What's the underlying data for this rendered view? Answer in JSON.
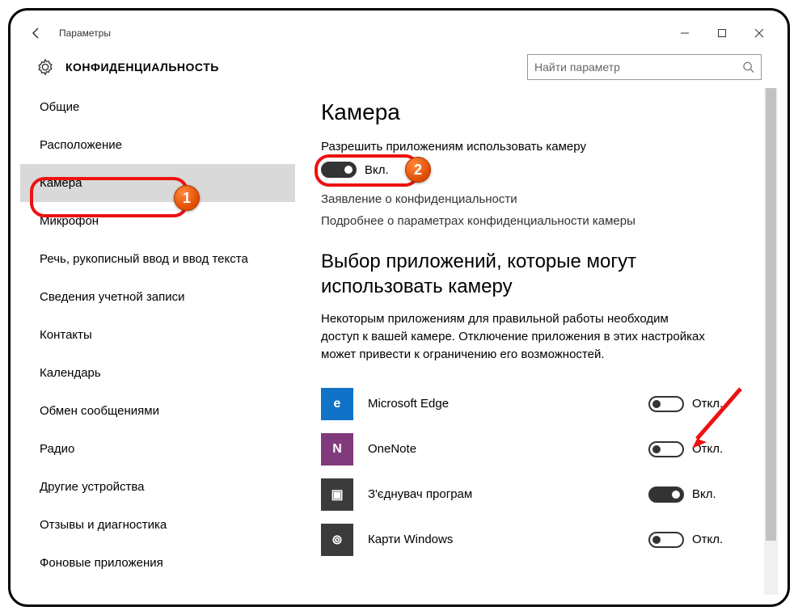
{
  "titlebar": {
    "title": "Параметры"
  },
  "header": {
    "section": "КОНФИДЕНЦИАЛЬНОСТЬ",
    "search_placeholder": "Найти параметр"
  },
  "sidebar": {
    "items": [
      {
        "label": "Общие"
      },
      {
        "label": "Расположение"
      },
      {
        "label": "Камера",
        "selected": true
      },
      {
        "label": "Микрофон"
      },
      {
        "label": "Речь, рукописный ввод и ввод текста"
      },
      {
        "label": "Сведения учетной записи"
      },
      {
        "label": "Контакты"
      },
      {
        "label": "Календарь"
      },
      {
        "label": "Обмен сообщениями"
      },
      {
        "label": "Радио"
      },
      {
        "label": "Другие устройства"
      },
      {
        "label": "Отзывы и диагностика"
      },
      {
        "label": "Фоновые приложения"
      }
    ]
  },
  "content": {
    "h1": "Камера",
    "allow_label": "Разрешить приложениям использовать камеру",
    "master_toggle": {
      "on": true,
      "state_text": "Вкл."
    },
    "link_privacy": "Заявление о конфиденциальности",
    "link_more": "Подробнее о параметрах конфиденциальности камеры",
    "h2": "Выбор приложений, которые могут использовать камеру",
    "para": "Некоторым приложениям для правильной работы необходим доступ к вашей камере. Отключение приложения в этих настройках может привести к ограничению его возможностей.",
    "state_on": "Вкл.",
    "state_off": "Откл.",
    "apps": [
      {
        "name": "Microsoft Edge",
        "icon": "edge",
        "glyph": "e",
        "on": false
      },
      {
        "name": "OneNote",
        "icon": "onenote",
        "glyph": "N",
        "on": false
      },
      {
        "name": "З'єднувач програм",
        "icon": "connector",
        "glyph": "▣",
        "on": true
      },
      {
        "name": "Карти Windows",
        "icon": "maps",
        "glyph": "⊚",
        "on": false
      }
    ]
  },
  "annotations": {
    "b1": "1",
    "b2": "2"
  }
}
